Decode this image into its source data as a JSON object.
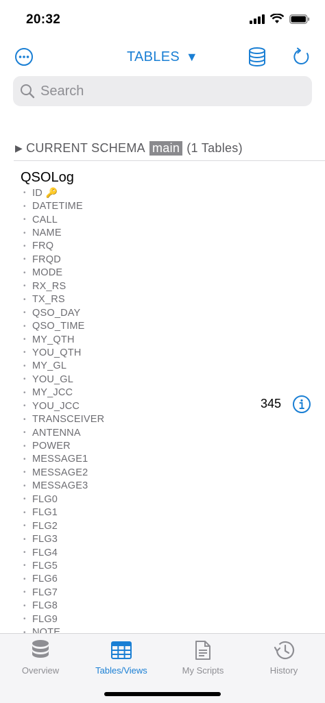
{
  "status_bar": {
    "time": "20:32"
  },
  "toolbar": {
    "title": "TABLES",
    "title_arrow": "▼"
  },
  "search": {
    "placeholder": "Search"
  },
  "schema": {
    "prefix": "CURRENT SCHEMA",
    "name": "main",
    "count_text": "(1 Tables)",
    "disclosure": "▶"
  },
  "table": {
    "name": "QSOLog",
    "row_count": "345",
    "key_icon": "🔑",
    "columns": [
      "ID",
      "DATETIME",
      "CALL",
      "NAME",
      "FRQ",
      "FRQD",
      "MODE",
      "RX_RS",
      "TX_RS",
      "QSO_DAY",
      "QSO_TIME",
      "MY_QTH",
      "YOU_QTH",
      "MY_GL",
      "YOU_GL",
      "MY_JCC",
      "YOU_JCC",
      "TRANSCEIVER",
      "ANTENNA",
      "POWER",
      "MESSAGE1",
      "MESSAGE2",
      "MESSAGE3",
      "FLG0",
      "FLG1",
      "FLG2",
      "FLG3",
      "FLG4",
      "FLG5",
      "FLG6",
      "FLG7",
      "FLG8",
      "FLG9",
      "NOTE"
    ]
  },
  "tabs": [
    {
      "label": "Overview",
      "icon": "database-icon",
      "active": false
    },
    {
      "label": "Tables/Views",
      "icon": "table-icon",
      "active": true
    },
    {
      "label": "My Scripts",
      "icon": "document-icon",
      "active": false
    },
    {
      "label": "History",
      "icon": "history-icon",
      "active": false
    }
  ],
  "colors": {
    "accent": "#1a7fd4",
    "muted": "#8e8e93",
    "column_text": "#6d6d72"
  }
}
